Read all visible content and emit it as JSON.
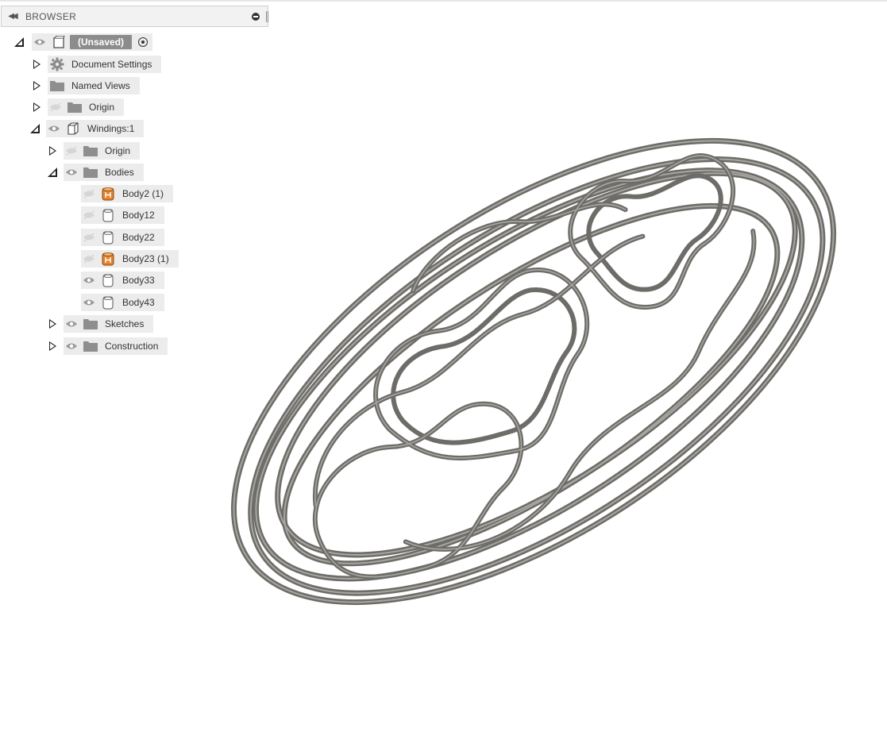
{
  "browser": {
    "title": "BROWSER",
    "collapse_glyph": "◀◀"
  },
  "tree": {
    "root": {
      "label": "(Unsaved)"
    },
    "document_settings": "Document Settings",
    "named_views": "Named Views",
    "origin": "Origin",
    "component": "Windings:1",
    "component_origin": "Origin",
    "bodies_folder": "Bodies",
    "bodies": [
      {
        "label": "Body2 (1)",
        "visible": false,
        "type": "orange"
      },
      {
        "label": "Body12",
        "visible": false,
        "type": "plain"
      },
      {
        "label": "Body22",
        "visible": false,
        "type": "plain"
      },
      {
        "label": "Body23 (1)",
        "visible": false,
        "type": "orange"
      },
      {
        "label": "Body33",
        "visible": true,
        "type": "plain"
      },
      {
        "label": "Body43",
        "visible": true,
        "type": "plain"
      }
    ],
    "sketches": "Sketches",
    "construction": "Construction"
  },
  "colors": {
    "wire": "#6e6c68",
    "wire_highlight": "#a8a6a1",
    "body_orange": "#e6822c"
  }
}
